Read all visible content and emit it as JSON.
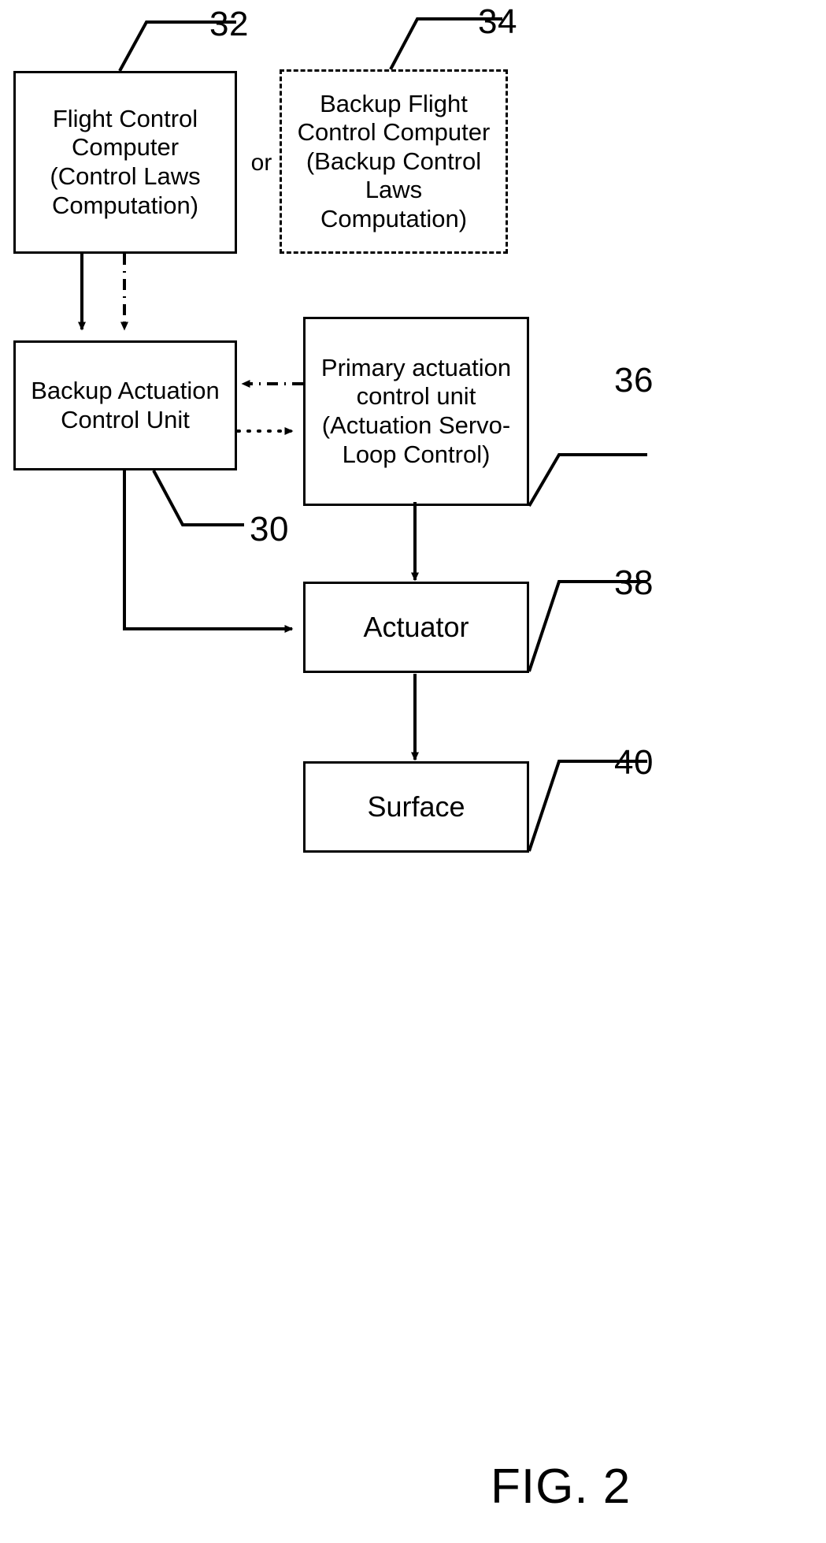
{
  "figure": {
    "caption": "FIG. 2",
    "background_color": "#ffffff",
    "line_color": "#000000"
  },
  "nodes": [
    {
      "id": "flight-control-computer",
      "label": "Flight Control\nComputer\n(Control Laws\nComputation)",
      "ref": "32",
      "border": "solid"
    },
    {
      "id": "backup-flight-control-computer",
      "label": "Backup Flight\nControl Computer\n(Backup Control\nLaws\nComputation)",
      "ref": "34",
      "border": "dashed"
    },
    {
      "id": "backup-actuation-control-unit",
      "label": "Backup Actuation\nControl Unit",
      "ref": "30",
      "border": "solid"
    },
    {
      "id": "primary-actuation-control-unit",
      "label": "Primary actuation\ncontrol unit\n(Actuation Servo-\nLoop Control)",
      "ref": "36",
      "border": "solid"
    },
    {
      "id": "actuator",
      "label": "Actuator",
      "ref": "38",
      "border": "solid"
    },
    {
      "id": "surface",
      "label": "Surface",
      "ref": "40",
      "border": "solid"
    }
  ],
  "connector_labels": {
    "or": "or"
  },
  "reference_numerals": {
    "n30": "30",
    "n32": "32",
    "n34": "34",
    "n36": "36",
    "n38": "38",
    "n40": "40"
  },
  "edges": [
    {
      "id": "fcc-to-bacu-solid",
      "from": "flight-control-computer",
      "to": "backup-actuation-control-unit",
      "style": "solid"
    },
    {
      "id": "bfcc-to-bacu-dashdot",
      "from": "backup-flight-control-computer",
      "to": "backup-actuation-control-unit",
      "style": "dash-dot"
    },
    {
      "id": "pacu-to-bacu-dashdot",
      "from": "primary-actuation-control-unit",
      "to": "backup-actuation-control-unit",
      "style": "dash-dot"
    },
    {
      "id": "bacu-to-pacu-dotted",
      "from": "backup-actuation-control-unit",
      "to": "primary-actuation-control-unit",
      "style": "dotted"
    },
    {
      "id": "pacu-to-actuator",
      "from": "primary-actuation-control-unit",
      "to": "actuator",
      "style": "solid"
    },
    {
      "id": "bacu-to-actuator",
      "from": "backup-actuation-control-unit",
      "to": "actuator",
      "style": "solid"
    },
    {
      "id": "actuator-to-surface",
      "from": "actuator",
      "to": "surface",
      "style": "solid"
    }
  ]
}
